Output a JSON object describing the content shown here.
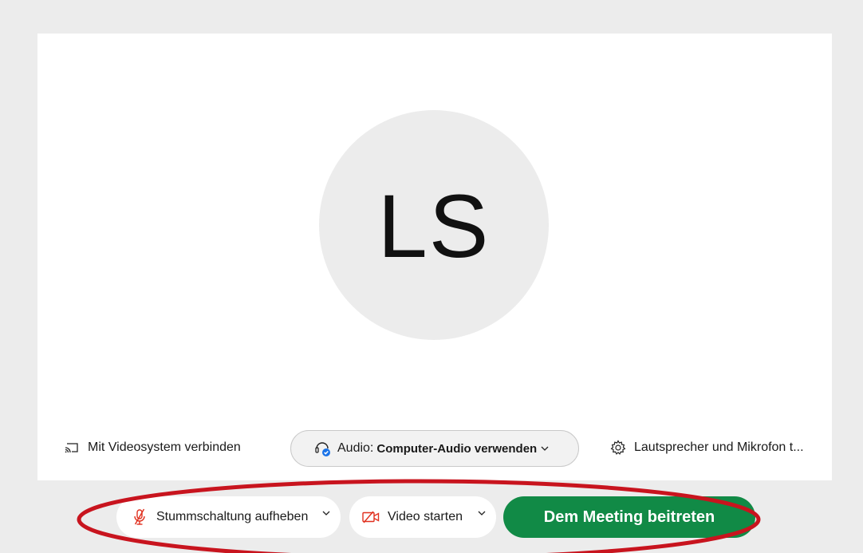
{
  "preview": {
    "initials": "LS"
  },
  "options": {
    "video_system_label": "Mit Videosystem verbinden",
    "audio_label": "Audio:",
    "audio_value": "Computer-Audio verwenden",
    "speaker_mic_label": "Lautsprecher und Mikrofon t..."
  },
  "controls": {
    "mute_label": "Stummschaltung aufheben",
    "video_label": "Video starten",
    "join_label": "Dem Meeting beitreten"
  },
  "icons": {
    "video_system": "cast-screen-icon",
    "audio": "headset-icon",
    "settings": "gear-icon",
    "mute": "microphone-muted-icon",
    "video": "camera-off-icon",
    "dropdown": "chevron-down-icon"
  },
  "colors": {
    "background": "#ececec",
    "panel": "#ffffff",
    "avatar": "#ececec",
    "join_button": "#118a46",
    "muted_icon": "#e0301e",
    "audio_check": "#1a73e8",
    "annotation": "#c8141e"
  }
}
